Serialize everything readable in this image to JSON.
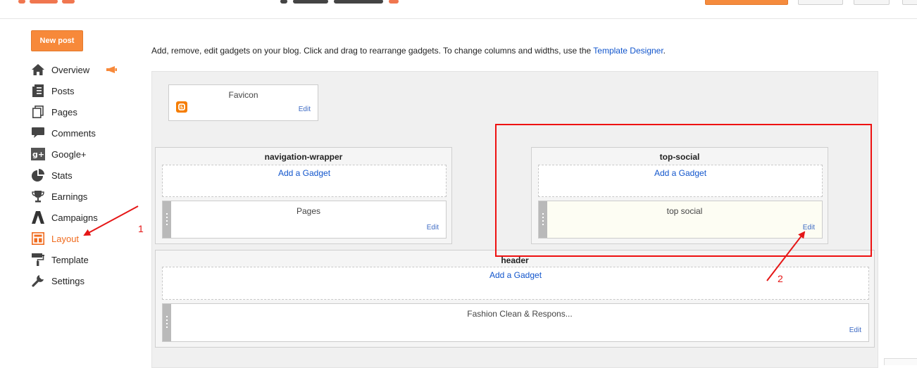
{
  "new_post": {
    "label": "New post"
  },
  "nav": {
    "items": [
      {
        "label": "Overview",
        "icon": "home-icon"
      },
      {
        "label": "Posts",
        "icon": "posts-icon"
      },
      {
        "label": "Pages",
        "icon": "pages-icon"
      },
      {
        "label": "Comments",
        "icon": "comments-icon"
      },
      {
        "label": "Google+",
        "icon": "google-plus-icon"
      },
      {
        "label": "Stats",
        "icon": "stats-icon"
      },
      {
        "label": "Earnings",
        "icon": "trophy-icon"
      },
      {
        "label": "Campaigns",
        "icon": "campaigns-icon"
      },
      {
        "label": "Layout",
        "icon": "layout-icon"
      },
      {
        "label": "Template",
        "icon": "template-icon"
      },
      {
        "label": "Settings",
        "icon": "wrench-icon"
      }
    ],
    "active": "Layout"
  },
  "intro": {
    "text": "Add, remove, edit gadgets on your blog. Click and drag to rearrange gadgets. To change columns and widths, use the ",
    "link": "Template Designer",
    "suffix": "."
  },
  "favicon": {
    "title": "Favicon",
    "edit": "Edit"
  },
  "sections": {
    "navigation_wrapper": {
      "title": "navigation-wrapper",
      "add_gadget": "Add a Gadget",
      "widgets": [
        {
          "name": "Pages",
          "edit": "Edit"
        }
      ]
    },
    "top_social": {
      "title": "top-social",
      "add_gadget": "Add a Gadget",
      "widgets": [
        {
          "name": "top social",
          "edit": "Edit"
        }
      ]
    },
    "header": {
      "title": "header",
      "add_gadget": "Add a Gadget",
      "widgets": [
        {
          "name": "Fashion Clean & Respons...",
          "edit": "Edit"
        }
      ]
    }
  },
  "annotations": {
    "label_1": "1",
    "label_2": "2"
  },
  "colors": {
    "accent_orange": "#f7893a",
    "link_blue": "#1155cc",
    "annotation_red": "#ee1111"
  }
}
